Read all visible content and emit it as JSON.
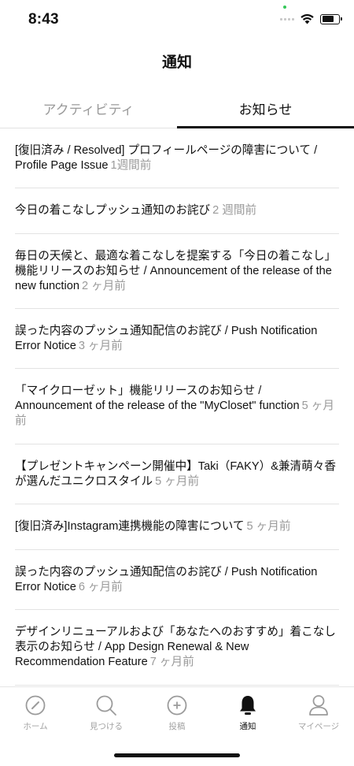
{
  "status_bar": {
    "time": "8:43"
  },
  "header": {
    "title": "通知"
  },
  "tabs": [
    {
      "label": "アクティビティ",
      "active": false
    },
    {
      "label": "お知らせ",
      "active": true
    }
  ],
  "notifications": [
    {
      "text": "[復旧済み / Resolved] プロフィールページの障害について / Profile Page Issue",
      "ago": "1週間前"
    },
    {
      "text": "今日の着こなしプッシュ通知のお詫び",
      "ago": "2 週間前"
    },
    {
      "text": "毎日の天候と、最適な着こなしを提案する「今日の着こなし」機能リリースのお知らせ / Announcement of the release of the new function",
      "ago": "2 ヶ月前"
    },
    {
      "text": "誤った内容のプッシュ通知配信のお詫び / Push Notification Error Notice",
      "ago": "3 ヶ月前"
    },
    {
      "text": "「マイクローゼット」機能リリースのお知らせ / Announcement of the release of the \"MyCloset\" function",
      "ago": "5 ヶ月前"
    },
    {
      "text": "【プレゼントキャンペーン開催中】Taki（FAKY）&兼清萌々香が選んだユニクロスタイル",
      "ago": "5 ヶ月前"
    },
    {
      "text": "[復旧済み]Instagram連携機能の障害について",
      "ago": "5 ヶ月前"
    },
    {
      "text": "誤った内容のプッシュ通知配信のお詫び / Push Notification Error Notice",
      "ago": "6 ヶ月前"
    },
    {
      "text": "デザインリニューアルおよび「あなたへのおすすめ」着こなし表示のお知らせ / App Design Renewal & New Recommendation Feature",
      "ago": "7 ヶ月前"
    }
  ],
  "bottom_nav": [
    {
      "label": "ホーム",
      "icon": "compass-icon",
      "active": false
    },
    {
      "label": "見つける",
      "icon": "search-icon",
      "active": false
    },
    {
      "label": "投稿",
      "icon": "plus-circle-icon",
      "active": false
    },
    {
      "label": "通知",
      "icon": "bell-icon",
      "active": true
    },
    {
      "label": "マイページ",
      "icon": "person-icon",
      "active": false
    }
  ],
  "colors": {
    "text": "#111111",
    "muted": "#9a9a9a",
    "divider": "#e3e3e3"
  }
}
